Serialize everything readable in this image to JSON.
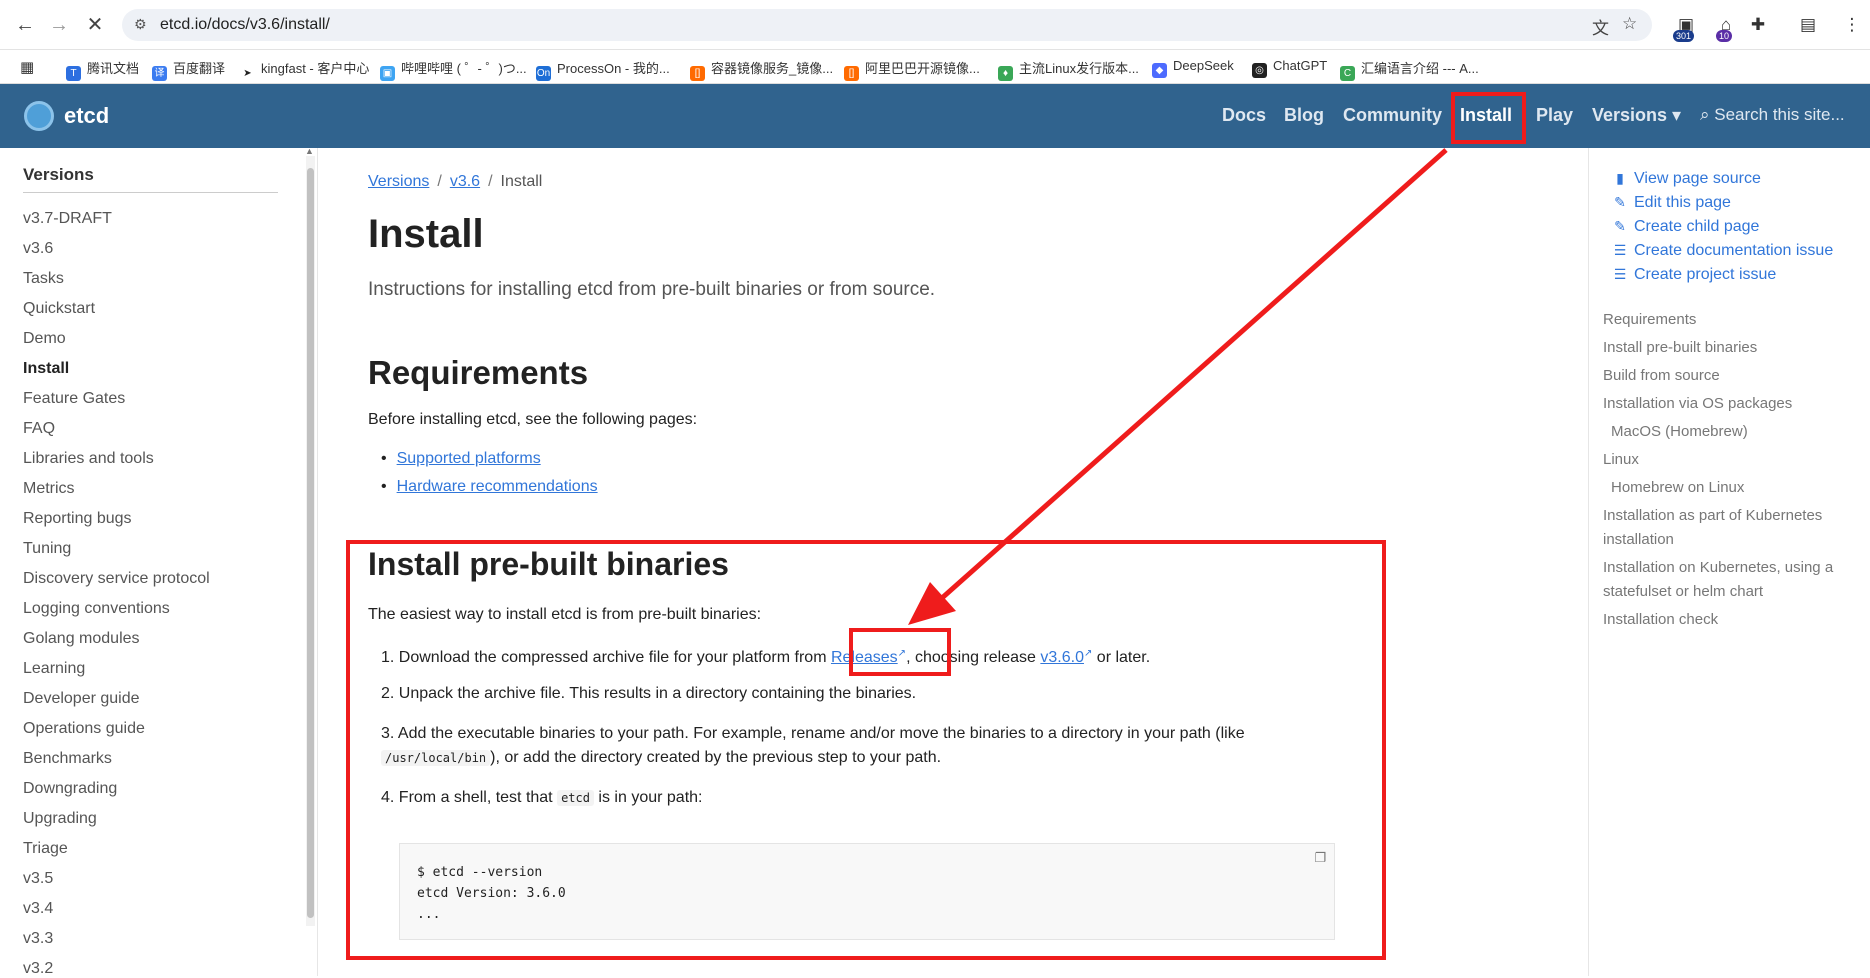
{
  "browser": {
    "url": "etcd.io/docs/v3.6/install/",
    "extensions": {
      "badge_1": "301",
      "badge_2": "10"
    },
    "bookmarks": [
      "腾讯文档",
      "百度翻译",
      "kingfast - 客户中心",
      "哔哩哔哩 ( ゜- ゜)つ...",
      "ProcessOn - 我的...",
      "容器镜像服务_镜像...",
      "阿里巴巴开源镜像...",
      "主流Linux发行版本...",
      "DeepSeek",
      "ChatGPT",
      "汇编语言介绍 --- A..."
    ]
  },
  "site": {
    "logo": "etcd",
    "nav": [
      "Docs",
      "Blog",
      "Community",
      "Install",
      "Play",
      "Versions ▾"
    ],
    "search_placeholder": "Search this site...",
    "brand_color": "#30638e"
  },
  "sidebar": {
    "heading": "Versions",
    "items": [
      "v3.7-DRAFT",
      "v3.6",
      "Tasks",
      "Quickstart",
      "Demo",
      "Install",
      "Feature Gates",
      "FAQ",
      "Libraries and tools",
      "Metrics",
      "Reporting bugs",
      "Tuning",
      "Discovery service protocol",
      "Logging conventions",
      "Golang modules",
      "Learning",
      "Developer guide",
      "Operations guide",
      "Benchmarks",
      "Downgrading",
      "Upgrading",
      "Triage",
      "v3.5",
      "v3.4",
      "v3.3",
      "v3.2"
    ],
    "active": "Install"
  },
  "main": {
    "breadcrumb": [
      "Versions",
      "v3.6",
      "Install"
    ],
    "title": "Install",
    "lead": "Instructions for installing etcd from pre-built binaries or from source.",
    "requirements": {
      "heading": "Requirements",
      "intro": "Before installing etcd, see the following pages:",
      "links": [
        "Supported platforms",
        "Hardware recommendations"
      ]
    },
    "prebuilt": {
      "heading": "Install pre-built binaries",
      "intro": "The easiest way to install etcd is from pre-built binaries:",
      "step1_a": "1. Download the compressed archive file for your platform from ",
      "step1_link1": "Releases",
      "step1_b": ", choosing release ",
      "step1_link2": "v3.6.0",
      "step1_c": " or later.",
      "step2": "2. Unpack the archive file. This results in a directory containing the binaries.",
      "step3_a": "3. Add the executable binaries to your path. For example, rename and/or move the binaries to a directory in your path (like ",
      "step3_code": "/usr/local/bin",
      "step3_b": "), or add the directory created by the previous step to your path.",
      "step4_a": "4. From a shell, test that ",
      "step4_code": "etcd",
      "step4_b": " is in your path:",
      "code_block": "$ etcd --version\netcd Version: 3.6.0\n..."
    }
  },
  "toc": {
    "actions": [
      "View page source",
      "Edit this page",
      "Create child page",
      "Create documentation issue",
      "Create project issue"
    ],
    "items": [
      "Requirements",
      "Install pre-built binaries",
      "Build from source",
      "Installation via OS packages",
      "MacOS (Homebrew)",
      "Linux",
      "Homebrew on Linux",
      "Installation as part of Kubernetes installation",
      "Installation on Kubernetes, using a statefulset or helm chart",
      "Installation check"
    ]
  },
  "annotation_color": "#ef1c1c"
}
